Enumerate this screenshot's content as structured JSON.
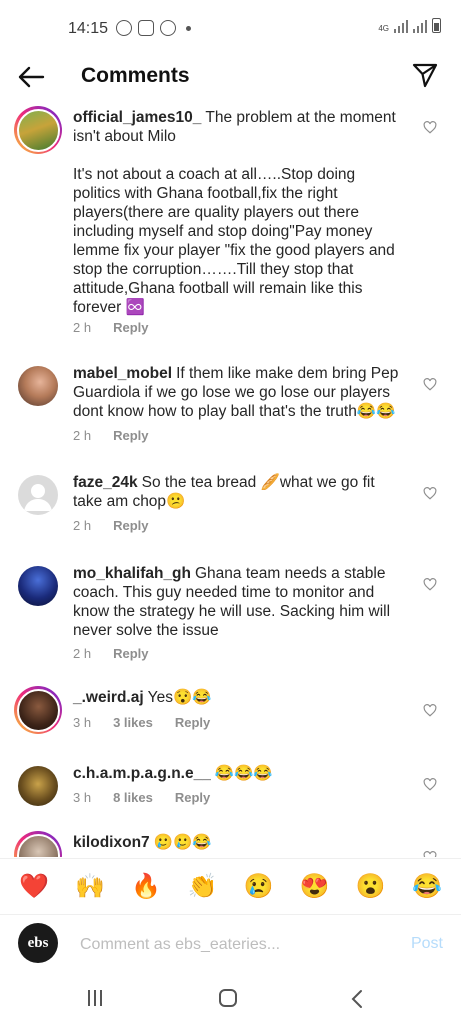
{
  "status_bar": {
    "time": "14:15",
    "network": "4G"
  },
  "header": {
    "title": "Comments",
    "back_icon": "arrow-left-icon",
    "send_icon": "paper-plane-icon"
  },
  "comments": [
    {
      "username": "official_james10_",
      "paragraphs": [
        "The problem at the moment isn't about Milo",
        "It's not about a coach at all…..Stop doing politics with Ghana football,fix the right players(there are quality players  out there including myself and stop  doing\"Pay money lemme fix your player \"fix the good players and stop the corruption…….Till they stop that attitude,Ghana football will remain like this forever ♾️"
      ],
      "time": "2 h",
      "likes": "",
      "reply": "Reply",
      "story_ring": true
    },
    {
      "username": "mabel_mobel",
      "paragraphs": [
        "If them like make dem bring Pep Guardiola if we go lose we go lose our players dont know how to play ball that's the truth😂😂"
      ],
      "time": "2 h",
      "likes": "",
      "reply": "Reply",
      "story_ring": false
    },
    {
      "username": "faze_24k",
      "paragraphs": [
        "So the tea bread 🥖what we go fit take  am chop😕"
      ],
      "time": "2 h",
      "likes": "",
      "reply": "Reply",
      "story_ring": false
    },
    {
      "username": "mo_khalifah_gh",
      "paragraphs": [
        "Ghana team needs a stable coach. This guy needed time to monitor and know the strategy he will use. Sacking him will never solve the issue"
      ],
      "time": "2 h",
      "likes": "",
      "reply": "Reply",
      "story_ring": false
    },
    {
      "username": "_.weird.aj",
      "paragraphs": [
        "Yes😯😂"
      ],
      "time": "3 h",
      "likes": "3 likes",
      "reply": "Reply",
      "story_ring": true
    },
    {
      "username": "c.h.a.m.p.a.g.n.e__",
      "paragraphs": [
        "😂😂😂"
      ],
      "time": "3 h",
      "likes": "8 likes",
      "reply": "Reply",
      "story_ring": false
    },
    {
      "username": "kilodixon7",
      "paragraphs": [
        "🥲🥲😂"
      ],
      "time": "",
      "likes": "",
      "reply": "",
      "story_ring": true
    }
  ],
  "reactions": [
    "❤️",
    "🙌",
    "🔥",
    "👏",
    "😢",
    "😍",
    "😮",
    "😂"
  ],
  "composer": {
    "avatar_text": "ebs",
    "placeholder": "Comment as ebs_eateries...",
    "post_label": "Post"
  },
  "colors": {
    "accent_blue_disabled": "#b6dcfb",
    "secondary_text": "#8e8e8e",
    "primary_text": "#262626"
  }
}
